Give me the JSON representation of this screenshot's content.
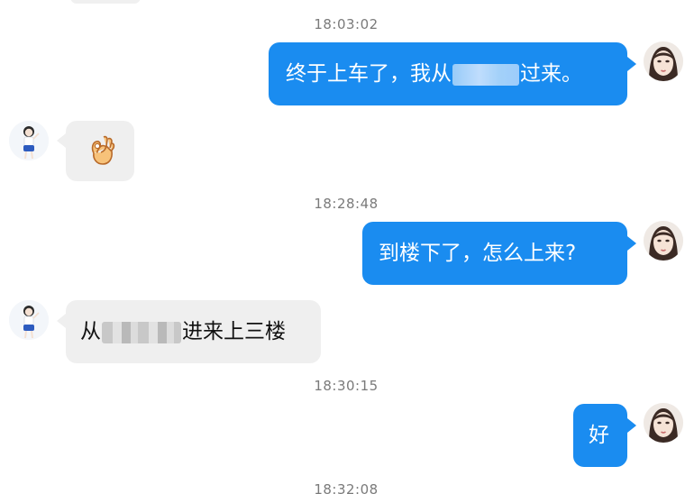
{
  "colors": {
    "sent_bubble": "#1a8cf0",
    "received_bubble": "#efefef",
    "timestamp_text": "#7a7a7a"
  },
  "messages": [
    {
      "type": "timestamp",
      "text": "18:03:02"
    },
    {
      "type": "sent",
      "text_before": "终于上车了，我从",
      "redacted": true,
      "text_after": "过来。",
      "avatar": "female-avatar-icon"
    },
    {
      "type": "received",
      "content": "ok-hand-emoji-icon",
      "avatar": "girl-avatar-icon"
    },
    {
      "type": "timestamp",
      "text": "18:28:48"
    },
    {
      "type": "sent",
      "text": "到楼下了，怎么上来?",
      "avatar": "female-avatar-icon"
    },
    {
      "type": "received",
      "text_before": "从",
      "redacted": true,
      "text_after": "进来上三楼",
      "avatar": "girl-avatar-icon"
    },
    {
      "type": "timestamp",
      "text": "18:30:15"
    },
    {
      "type": "sent",
      "text": "好",
      "avatar": "female-avatar-icon"
    },
    {
      "type": "timestamp",
      "text": "18:32:08"
    }
  ]
}
